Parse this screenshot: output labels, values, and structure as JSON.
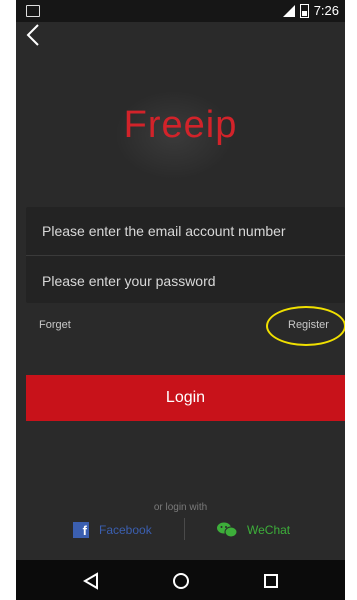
{
  "status": {
    "time": "7:26"
  },
  "app": {
    "logo": "Freeip"
  },
  "form": {
    "email_placeholder": "Please enter the email account number",
    "password_placeholder": "Please enter your password"
  },
  "links": {
    "forget": "Forget",
    "register": "Register"
  },
  "login_button": "Login",
  "social": {
    "prompt": "or login with",
    "facebook": "Facebook",
    "wechat": "WeChat"
  },
  "icons": [
    "back-arrow-icon",
    "facebook-icon",
    "wechat-icon",
    "nav-back-icon",
    "nav-home-icon",
    "nav-recents-icon"
  ],
  "colors": {
    "accent": "#c8121a",
    "facebook": "#3b5fb0",
    "wechat": "#3dae3a",
    "highlight": "#f0e000"
  }
}
